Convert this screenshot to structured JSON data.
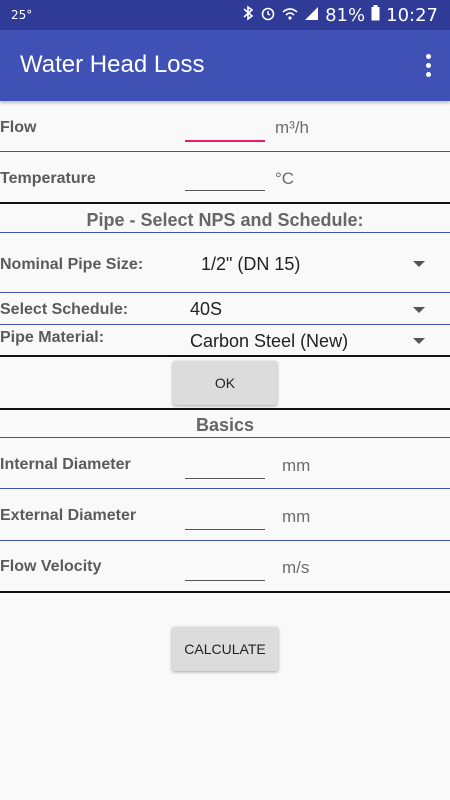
{
  "status_bar": {
    "temperature": "25°",
    "battery": "81%",
    "time": "10:27"
  },
  "app": {
    "title": "Water Head Loss"
  },
  "flow": {
    "label": "Flow",
    "value": "",
    "unit": "m³/h"
  },
  "temperature": {
    "label": "Temperature",
    "value": "",
    "unit": "°C"
  },
  "pipe_section": {
    "heading": "Pipe - Select NPS and Schedule:"
  },
  "nominal_pipe_size": {
    "label": "Nominal Pipe Size:",
    "selected": "1/2\" (DN 15)"
  },
  "schedule": {
    "label": "Select Schedule:",
    "selected": "40S"
  },
  "material": {
    "label": "Pipe Material:",
    "selected": "Carbon Steel (New)"
  },
  "ok_button": {
    "label": "OK"
  },
  "basics_section": {
    "heading": "Basics"
  },
  "internal_diameter": {
    "label": "Internal Diameter",
    "value": "",
    "unit": "mm"
  },
  "external_diameter": {
    "label": "External Diameter",
    "value": "",
    "unit": "mm"
  },
  "flow_velocity": {
    "label": "Flow Velocity",
    "value": "",
    "unit": "m/s"
  },
  "calculate_button": {
    "label": "CALCULATE"
  },
  "colors": {
    "primary": "#3f51b5",
    "primary_dark": "#2f3b97",
    "accent": "#e91e63"
  },
  "icons": [
    "bluetooth-icon",
    "alarm-icon",
    "wifi-icon",
    "signal-icon",
    "battery-icon",
    "more-vert-icon"
  ]
}
